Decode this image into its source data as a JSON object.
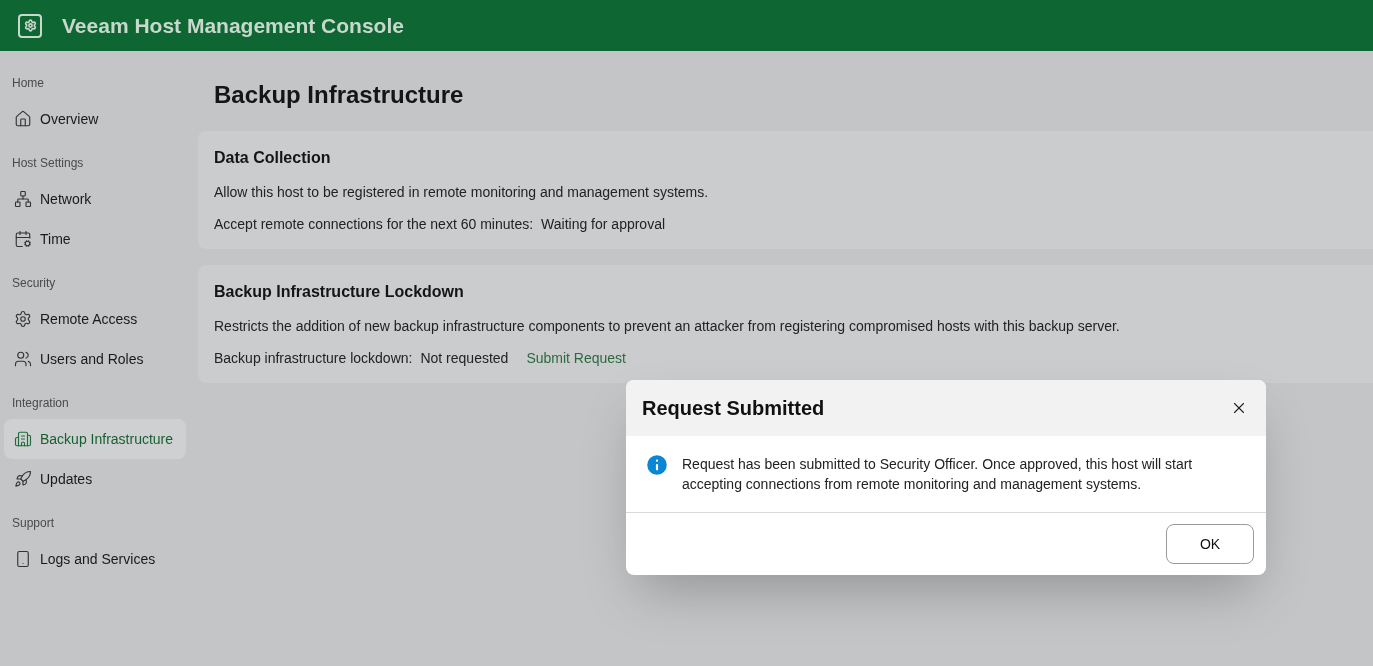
{
  "header": {
    "title": "Veeam Host Management Console"
  },
  "sidebar": {
    "sections": [
      {
        "heading": "Home",
        "items": [
          {
            "label": "Overview",
            "selected": false
          }
        ]
      },
      {
        "heading": "Host Settings",
        "items": [
          {
            "label": "Network",
            "selected": false
          },
          {
            "label": "Time",
            "selected": false
          }
        ]
      },
      {
        "heading": "Security",
        "items": [
          {
            "label": "Remote Access",
            "selected": false
          },
          {
            "label": "Users and Roles",
            "selected": false
          }
        ]
      },
      {
        "heading": "Integration",
        "items": [
          {
            "label": "Backup Infrastructure",
            "selected": true
          },
          {
            "label": "Updates",
            "selected": false
          }
        ]
      },
      {
        "heading": "Support",
        "items": [
          {
            "label": "Logs and Services",
            "selected": false
          }
        ]
      }
    ]
  },
  "page": {
    "title": "Backup Infrastructure",
    "cards": [
      {
        "title": "Data Collection",
        "description": "Allow this host to be registered in remote monitoring and management systems.",
        "status": {
          "label": "Accept remote connections for the next 60 minutes:",
          "value": "Waiting for approval"
        }
      },
      {
        "title": "Backup Infrastructure Lockdown",
        "description": "Restricts the addition of new backup infrastructure components to prevent an attacker from registering compromised hosts with this backup server.",
        "status": {
          "label": "Backup infrastructure lockdown:",
          "value": "Not requested",
          "link": "Submit Request"
        }
      }
    ]
  },
  "dialog": {
    "title": "Request Submitted",
    "message": "Request has been submitted to Security Officer. Once approved, this host will start accepting connections from remote monitoring and management systems.",
    "button": "OK"
  }
}
